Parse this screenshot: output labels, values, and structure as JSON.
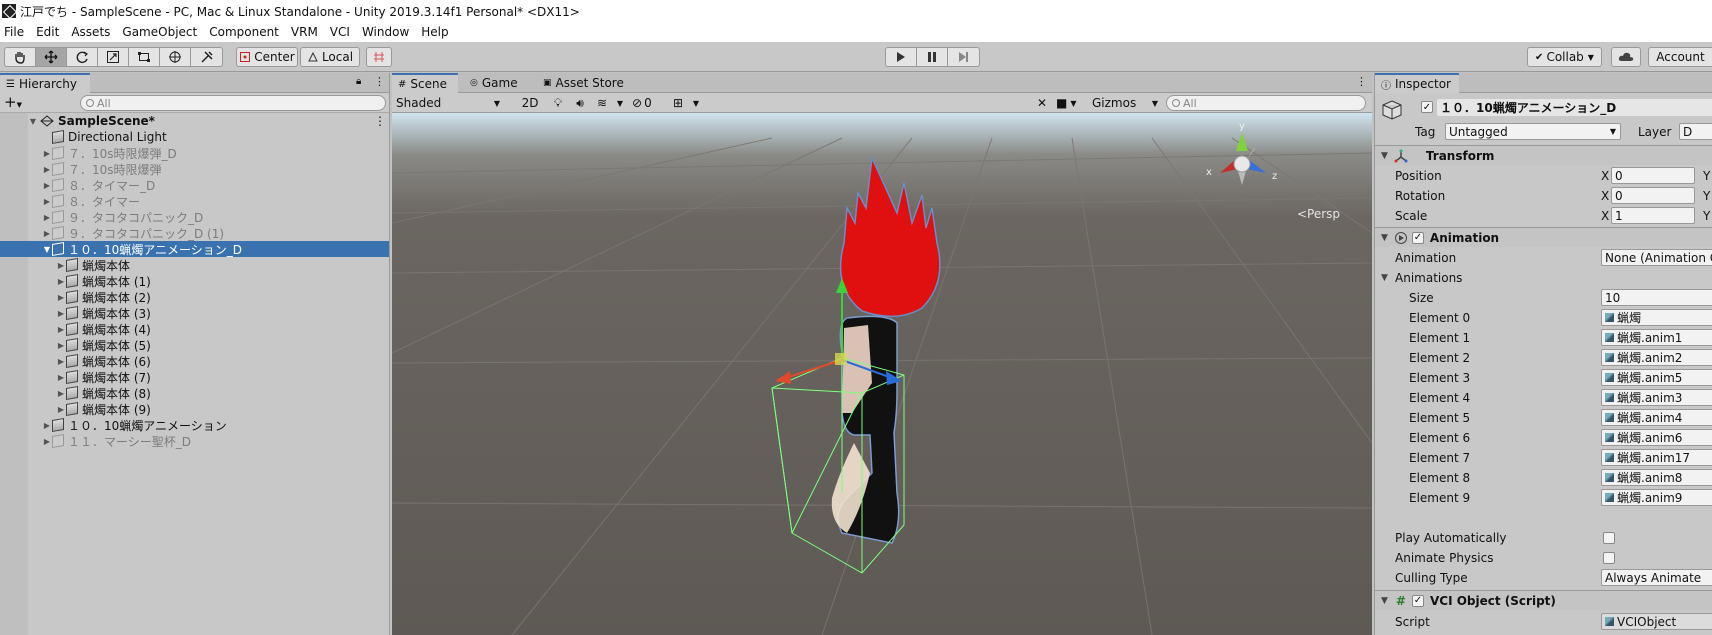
{
  "window": {
    "title": "江戸でち - SampleScene - PC, Mac & Linux Standalone - Unity 2019.3.14f1 Personal* <DX11>"
  },
  "menu": [
    "File",
    "Edit",
    "Assets",
    "GameObject",
    "Component",
    "VRM",
    "VCI",
    "Window",
    "Help"
  ],
  "toolbar": {
    "pivot": "Center",
    "space": "Local",
    "collab": "Collab",
    "account": "Account"
  },
  "hierarchy": {
    "tab": "Hierarchy",
    "search_placeholder": "All",
    "scene_name": "SampleScene*",
    "rows": [
      {
        "label": "Directional Light",
        "depth": 1,
        "arrow": "",
        "dim": false,
        "sel": false
      },
      {
        "label": "７．10s時限爆弾_D",
        "depth": 1,
        "arrow": "▶",
        "dim": true,
        "sel": false
      },
      {
        "label": "７．10s時限爆弾",
        "depth": 1,
        "arrow": "▶",
        "dim": true,
        "sel": false
      },
      {
        "label": "８．タイマー_D",
        "depth": 1,
        "arrow": "▶",
        "dim": true,
        "sel": false
      },
      {
        "label": "８．タイマー",
        "depth": 1,
        "arrow": "▶",
        "dim": true,
        "sel": false
      },
      {
        "label": "９．タコタコパニック_D",
        "depth": 1,
        "arrow": "▶",
        "dim": true,
        "sel": false
      },
      {
        "label": "９．タコタコパニック_D (1)",
        "depth": 1,
        "arrow": "▶",
        "dim": true,
        "sel": false
      },
      {
        "label": "１０．10蝋燭アニメーション_D",
        "depth": 1,
        "arrow": "▼",
        "dim": false,
        "sel": true
      },
      {
        "label": "蝋燭本体",
        "depth": 2,
        "arrow": "▶",
        "dim": false,
        "sel": false
      },
      {
        "label": "蝋燭本体 (1)",
        "depth": 2,
        "arrow": "▶",
        "dim": false,
        "sel": false
      },
      {
        "label": "蝋燭本体 (2)",
        "depth": 2,
        "arrow": "▶",
        "dim": false,
        "sel": false
      },
      {
        "label": "蝋燭本体 (3)",
        "depth": 2,
        "arrow": "▶",
        "dim": false,
        "sel": false
      },
      {
        "label": "蝋燭本体 (4)",
        "depth": 2,
        "arrow": "▶",
        "dim": false,
        "sel": false
      },
      {
        "label": "蝋燭本体 (5)",
        "depth": 2,
        "arrow": "▶",
        "dim": false,
        "sel": false
      },
      {
        "label": "蝋燭本体 (6)",
        "depth": 2,
        "arrow": "▶",
        "dim": false,
        "sel": false
      },
      {
        "label": "蝋燭本体 (7)",
        "depth": 2,
        "arrow": "▶",
        "dim": false,
        "sel": false
      },
      {
        "label": "蝋燭本体 (8)",
        "depth": 2,
        "arrow": "▶",
        "dim": false,
        "sel": false
      },
      {
        "label": "蝋燭本体 (9)",
        "depth": 2,
        "arrow": "▶",
        "dim": false,
        "sel": false
      },
      {
        "label": "１０．10蝋燭アニメーション",
        "depth": 1,
        "arrow": "▶",
        "dim": false,
        "sel": false
      },
      {
        "label": "１１．マーシー聖杯_D",
        "depth": 1,
        "arrow": "▶",
        "dim": true,
        "sel": false
      }
    ]
  },
  "scene": {
    "tabs": [
      "Scene",
      "Game",
      "Asset Store"
    ],
    "shading": "Shaded",
    "mode_2d": "2D",
    "hidden_count": "0",
    "gizmos": "Gizmos",
    "search_placeholder": "All",
    "persp": "<Persp",
    "axis_x": "x",
    "axis_y": "y",
    "axis_z": "z"
  },
  "inspector": {
    "tab": "Inspector",
    "object_name": "１０．10蝋燭アニメーション_D",
    "tag_label": "Tag",
    "tag_value": "Untagged",
    "layer_label": "Layer",
    "layer_value": "D",
    "transform": {
      "title": "Transform",
      "position_label": "Position",
      "rotation_label": "Rotation",
      "scale_label": "Scale",
      "x_label": "X",
      "y_label": "Y",
      "position_x": "0",
      "rotation_x": "0",
      "scale_x": "1"
    },
    "animation": {
      "title": "Animation",
      "animation_label": "Animation",
      "animation_value": "None (Animation Cli",
      "animations_label": "Animations",
      "size_label": "Size",
      "size_value": "10",
      "elements": [
        {
          "label": "Element 0",
          "value": "蝋燭"
        },
        {
          "label": "Element 1",
          "value": "蝋燭.anim1"
        },
        {
          "label": "Element 2",
          "value": "蝋燭.anim2"
        },
        {
          "label": "Element 3",
          "value": "蝋燭.anim5"
        },
        {
          "label": "Element 4",
          "value": "蝋燭.anim3"
        },
        {
          "label": "Element 5",
          "value": "蝋燭.anim4"
        },
        {
          "label": "Element 6",
          "value": "蝋燭.anim6"
        },
        {
          "label": "Element 7",
          "value": "蝋燭.anim17"
        },
        {
          "label": "Element 8",
          "value": "蝋燭.anim8"
        },
        {
          "label": "Element 9",
          "value": "蝋燭.anim9"
        }
      ],
      "play_auto_label": "Play Automatically",
      "animate_physics_label": "Animate Physics",
      "culling_label": "Culling Type",
      "culling_value": "Always Animate"
    },
    "vci": {
      "title": "VCI Object (Script)",
      "script_label": "Script",
      "script_value": "VCIObject"
    }
  }
}
